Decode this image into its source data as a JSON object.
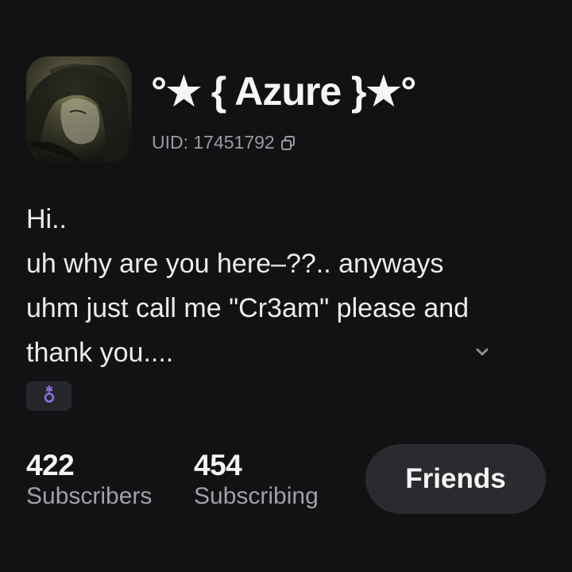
{
  "profile": {
    "display_name": "°★ { Azure }★°",
    "uid_label": "UID: 17451792",
    "avatar_icon": "avatar-image",
    "copy_icon": "copy-icon"
  },
  "bio": {
    "lines": [
      "Hi..",
      "uh why are you here–??.. anyways",
      "uhm just call me \"Cr3am\" please and",
      "thank you...."
    ],
    "expand_icon": "chevron-down-icon"
  },
  "badge": {
    "icon": "gender-badge-icon",
    "color": "#8b6bd6"
  },
  "stats": {
    "subscribers": {
      "value": "422",
      "label": "Subscribers"
    },
    "subscribing": {
      "value": "454",
      "label": "Subscribing"
    }
  },
  "actions": {
    "friends_label": "Friends"
  },
  "colors": {
    "background": "#121214",
    "button_bg": "#2a2a2f",
    "muted_text": "#9a9aa0",
    "badge_accent": "#8b6bd6"
  }
}
